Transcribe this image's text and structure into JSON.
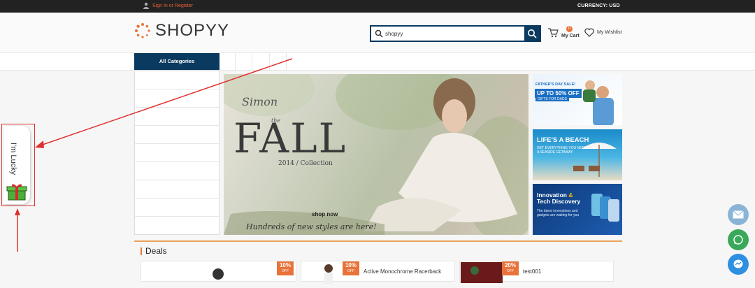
{
  "topbar": {
    "signin_label": "Sign In or Register",
    "currency_label": "CURRENCY:",
    "currency_value": "USD",
    "currency_text": "CURRENCY: USD"
  },
  "header": {
    "brand": "SHOPYY",
    "search": {
      "value": "shopyy",
      "placeholder": ""
    },
    "cart": {
      "count": "0",
      "label": "My Cart"
    },
    "wishlist_label": "My Wishlist"
  },
  "nav": {
    "all_categories": "All Categories"
  },
  "banner": {
    "simon": "Simon",
    "the": "the",
    "fall": "FALL",
    "collection": "2014 / Collection",
    "shop_now": "shop now",
    "tagline": "Hundreds of new styles are here!"
  },
  "side_ads": [
    {
      "title": "FATHER'S DAY SALE!",
      "headline": "UP TO 50% OFF",
      "sub": "GIFTS FOR DADS"
    },
    {
      "title": "LIFE'S A BEACH",
      "sub": "GET EVERYTHING YOU NEED FOR A SEASIDE GETAWAY"
    },
    {
      "title_a": "Innovation",
      "amp": "&",
      "title_b": "Tech Discovery",
      "sub": "The latest innovations and gadgets are waiting for you"
    }
  ],
  "deals": {
    "heading": "Deals",
    "items": [
      {
        "discount": "10%",
        "off": "OFF",
        "title": ""
      },
      {
        "discount": "10%",
        "off": "OFF",
        "title": "Active Monochrome Racerback"
      },
      {
        "discount": "20%",
        "off": "OFF",
        "title": "test001"
      }
    ]
  },
  "lucky": {
    "label": "I'm Lucky"
  },
  "colors": {
    "navy": "#0a3a5f",
    "accent": "#e8733a",
    "annotation": "#e03030"
  },
  "floating_icons": [
    "mail-icon",
    "whatsapp-icon",
    "messenger-icon"
  ]
}
